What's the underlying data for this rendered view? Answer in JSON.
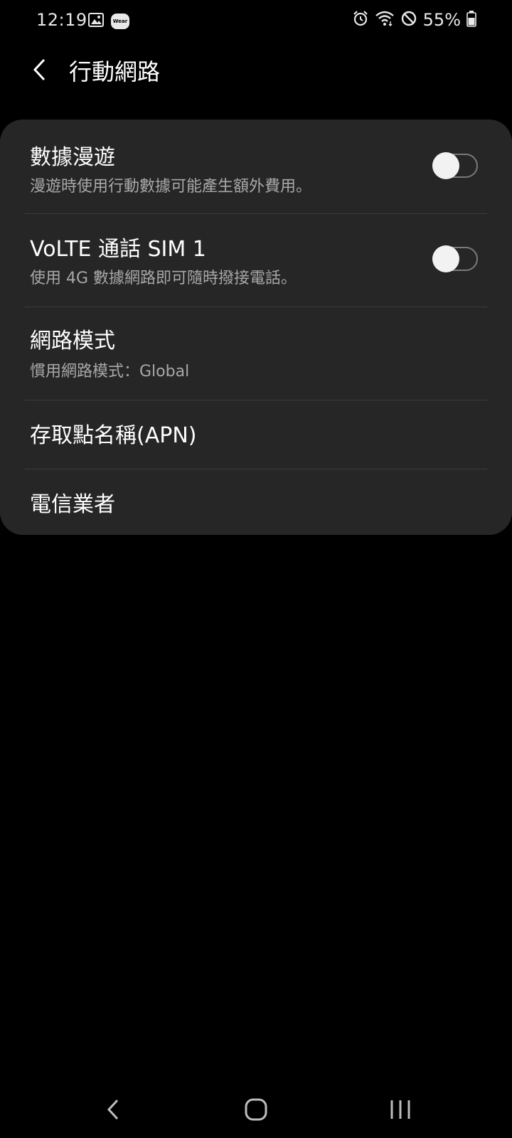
{
  "status_bar": {
    "time": "12:19",
    "wear_label": "Wear",
    "battery": "55%"
  },
  "header": {
    "title": "行動網路"
  },
  "settings": {
    "roaming": {
      "title": "數據漫遊",
      "subtitle": "漫遊時使用行動數據可能產生額外費用。",
      "enabled": false
    },
    "volte": {
      "title": "VoLTE 通話 SIM 1",
      "subtitle": "使用 4G 數據網路即可隨時撥接電話。",
      "enabled": false
    },
    "network_mode": {
      "title": "網路模式",
      "subtitle": "慣用網路模式：Global"
    },
    "apn": {
      "title": "存取點名稱(APN)"
    },
    "carrier": {
      "title": "電信業者"
    }
  },
  "colors": {
    "background": "#000000",
    "card": "#262626",
    "divider": "#3c3c3c",
    "subtitle": "#a8a8a8"
  }
}
